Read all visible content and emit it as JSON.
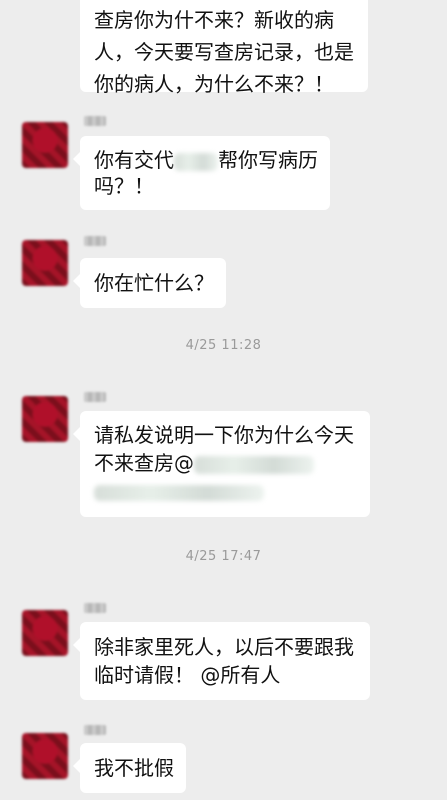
{
  "messages": {
    "m0": {
      "line1": "查房你为什不来？新收的病",
      "line2": "人，今天要写查房记录，也是",
      "line3": "你的病人，为什么不来？！"
    },
    "m1": {
      "line1_a": "你有交代",
      "line1_b": "帮你写病历",
      "line2": "吗？！"
    },
    "m2": {
      "line1": "你在忙什么？"
    },
    "m3": {
      "line1": "请私发说明一下你为什么今天",
      "line2": "不来查房@"
    },
    "m4": {
      "line1": "除非家里死人，以后不要跟我",
      "line2": "临时请假！ @所有人"
    },
    "m5": {
      "line1": "我不批假"
    }
  },
  "timestamps": {
    "t1": "4/25 11:28",
    "t2": "4/25 17:47"
  },
  "icons": {
    "avatar": "avatar-image-pixelated"
  }
}
